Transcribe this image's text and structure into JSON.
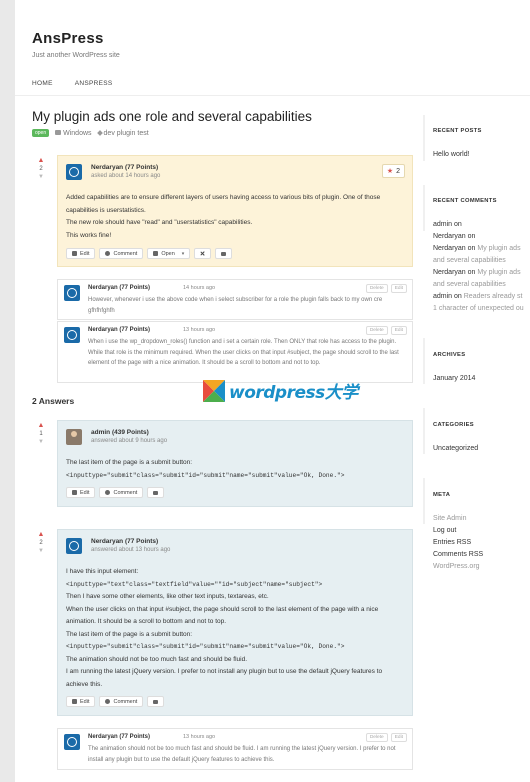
{
  "site": {
    "title": "AnsPress",
    "tagline": "Just another WordPress site"
  },
  "nav": [
    "HOME",
    "ANSPRESS"
  ],
  "question": {
    "title": "My plugin ads one role and several capabilities",
    "status": "open",
    "category": "Windows",
    "tag": "dev plugin test",
    "votes": "2",
    "author": "Nerdaryan (77 Points)",
    "time": "asked about 14 hours ago",
    "favorites": "2",
    "body": [
      "Added capabilities are to ensure different layers of users having access to various bits of plugin. One of those capabilities is userstatistics.",
      "The new role should have \"read\" and \"userstatistics\" capabilities.",
      "This works fine!"
    ],
    "buttons": {
      "edit": "Edit",
      "comment": "Comment",
      "status": "Open"
    }
  },
  "question_comments": [
    {
      "author": "Nerdaryan (77 Points)",
      "time": "14 hours ago",
      "text": "However, whenever i use the above code when i select subscriber for a role the plugin falls back to my own cre gfhfhfghfh",
      "actions": [
        "Delete",
        "Edit"
      ]
    },
    {
      "author": "Nerdaryan (77 Points)",
      "time": "13 hours ago",
      "text": "When i use the wp_dropdown_roles() function and i set a certain role. Then ONLY that role has access to the plugin. While that role is the minimum required. When the user clicks on that input #subject, the page should scroll to the last element of the page with a nice animation. It should be a scroll to bottom and not to top.",
      "actions": [
        "Delete",
        "Edit"
      ]
    }
  ],
  "answers_heading": "2 Answers",
  "answers": [
    {
      "votes": "1",
      "author": "admin (439 Points)",
      "time": "answered about 9 hours ago",
      "lines": [
        {
          "t": "text",
          "v": "The last item of the page is a submit button:"
        },
        {
          "t": "code",
          "v": "<inputtype=\"submit\"class=\"submit\"id=\"submit\"name=\"submit\"value=\"Ok, Done.\">"
        }
      ],
      "buttons": {
        "edit": "Edit",
        "comment": "Comment"
      }
    },
    {
      "votes": "2",
      "author": "Nerdaryan (77 Points)",
      "time": "answered about 13 hours ago",
      "lines": [
        {
          "t": "text",
          "v": "I have this input element:"
        },
        {
          "t": "code",
          "v": "<inputtype=\"text\"class=\"textfield\"value=\"\"id=\"subject\"name=\"subject\">"
        },
        {
          "t": "text",
          "v": "Then I have some other elements, like other text inputs, textareas, etc."
        },
        {
          "t": "text",
          "v": "When the user clicks on that input #subject, the page should scroll to the last element of the page with a nice animation. It should be a scroll to bottom and not to top."
        },
        {
          "t": "text",
          "v": "The last item of the page is a submit button:"
        },
        {
          "t": "code",
          "v": "<inputtype=\"submit\"class=\"submit\"id=\"submit\"name=\"submit\"value=\"Ok, Done.\">"
        },
        {
          "t": "text",
          "v": "The animation should not be too much fast and should be fluid."
        },
        {
          "t": "text",
          "v": "I am running the latest jQuery version. I prefer to not install any plugin but to use the default jQuery features to achieve this."
        }
      ],
      "buttons": {
        "edit": "Edit",
        "comment": "Comment"
      }
    }
  ],
  "answer_comment": {
    "author": "Nerdaryan (77 Points)",
    "time": "13 hours ago",
    "text": "The animation should not be too much fast and should be fluid. I am running the latest jQuery version. I prefer to not install any plugin but to use the default jQuery features to achieve this.",
    "actions": [
      "Delete",
      "Edit"
    ]
  },
  "sidebar": {
    "recent_posts": {
      "title": "RECENT POSTS",
      "items": [
        "Hello world!"
      ]
    },
    "recent_comments": {
      "title": "RECENT COMMENTS",
      "items": [
        {
          "who": "admin on",
          "link": ""
        },
        {
          "who": "Nerdaryan on",
          "link": ""
        },
        {
          "who": "Nerdaryan on",
          "link": "My plugin ads"
        },
        {
          "who": "",
          "link": "and several capabilities"
        },
        {
          "who": "Nerdaryan on",
          "link": "My plugin ads"
        },
        {
          "who": "",
          "link": "and several capabilities"
        },
        {
          "who": "admin on",
          "link": "Readers already st"
        },
        {
          "who": "",
          "link": "1 character of unexpected ou"
        }
      ]
    },
    "archives": {
      "title": "ARCHIVES",
      "items": [
        "January 2014"
      ]
    },
    "categories": {
      "title": "CATEGORIES",
      "items": [
        "Uncategorized"
      ]
    },
    "meta": {
      "title": "META",
      "items": [
        "Site Admin",
        "Log out",
        "Entries RSS",
        "Comments RSS",
        "WordPress.org"
      ]
    }
  },
  "watermark": "wordpress大学",
  "colors": {
    "question_bg": "#fdf3d9",
    "answer_bg": "#e6eff2",
    "accent_red": "#d9534f",
    "open_badge": "#5cb85c"
  }
}
